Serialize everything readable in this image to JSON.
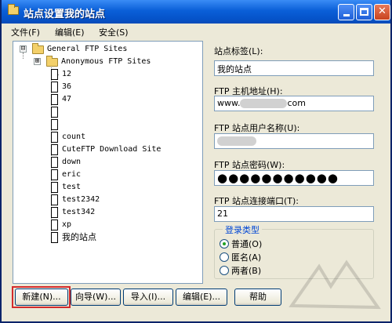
{
  "window": {
    "title": "站点设置我的站点",
    "colors": {
      "titlebar": "#0553c9",
      "close": "#c8431f",
      "highlight": "#d32b2b",
      "group_title": "#0046d5"
    }
  },
  "menu": {
    "items": [
      "文件(F)",
      "编辑(E)",
      "安全(S)"
    ]
  },
  "tree": {
    "root": {
      "label": "General FTP Sites",
      "expander": "⊟",
      "icon": "folder-open-icon"
    },
    "group": {
      "label": "Anonymous FTP Sites",
      "expander": "⊞",
      "icon": "folder-icon"
    },
    "sites": [
      "12",
      "36",
      "47",
      "",
      "",
      "count",
      "CuteFTP Download Site",
      "down",
      "eric",
      "test",
      "test2342",
      "test342",
      "xp",
      "我的站点"
    ]
  },
  "form": {
    "site_label": {
      "label": "站点标签(L):",
      "value": "我的站点"
    },
    "host": {
      "label": "FTP 主机地址(H):",
      "value_prefix": "www.",
      "value_suffix": "com"
    },
    "user": {
      "label": "FTP 站点用户名称(U):",
      "value": ""
    },
    "password": {
      "label": "FTP 站点密码(W):",
      "value": "●●●●●●●●●●●"
    },
    "port": {
      "label": "FTP 站点连接端口(T):",
      "value": "21"
    },
    "login_type": {
      "title": "登录类型",
      "options": [
        {
          "label": "普通(O)",
          "selected": true
        },
        {
          "label": "匿名(A)",
          "selected": false
        },
        {
          "label": "两者(B)",
          "selected": false
        }
      ]
    }
  },
  "buttons": {
    "new": "新建(N)...",
    "wizard": "向导(W)...",
    "import": "导入(I)...",
    "edit": "编辑(E)...",
    "help": "帮助"
  }
}
